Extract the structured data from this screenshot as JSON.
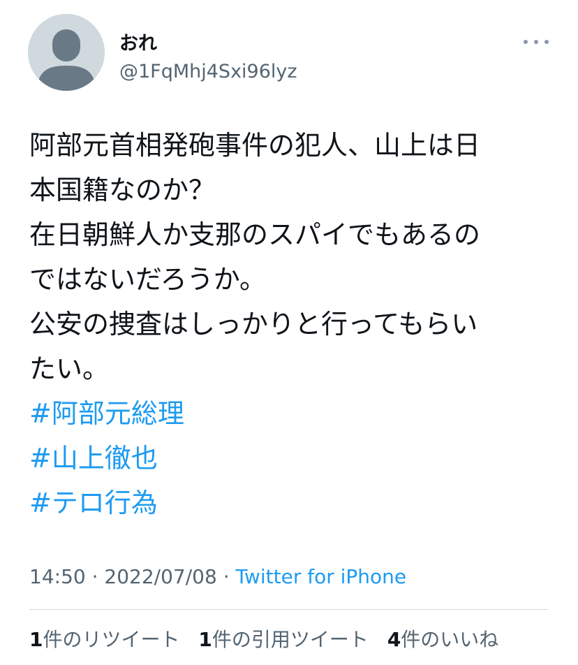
{
  "user": {
    "display_name": "おれ",
    "handle": "@1FqMhj4Sxi96lyz"
  },
  "tweet": {
    "lines": [
      "阿部元首相発砲事件の犯人、山上は日",
      "本国籍なのか？",
      "在日朝鮮人か支那のスパイでもあるの",
      "ではないだろうか。",
      "公安の捜査はしっかりと行ってもらい",
      "たい。"
    ],
    "hashtags": [
      "#阿部元総理",
      "#山上徹也",
      "#テロ行為"
    ]
  },
  "meta": {
    "time": "14:50",
    "separator": " · ",
    "date": "2022/07/08",
    "source": "Twitter for iPhone"
  },
  "stats": {
    "retweets_count": "1",
    "retweets_label": "件のリツイート",
    "quotes_count": "1",
    "quotes_label": "件の引用ツイート",
    "likes_count": "4",
    "likes_label": "件のいいね"
  },
  "colors": {
    "link": "#1d9bf0",
    "secondary_text": "#536471",
    "avatar_bg": "#cfd9de"
  },
  "icons": [
    "avatar-placeholder-icon",
    "more-options-icon"
  ]
}
